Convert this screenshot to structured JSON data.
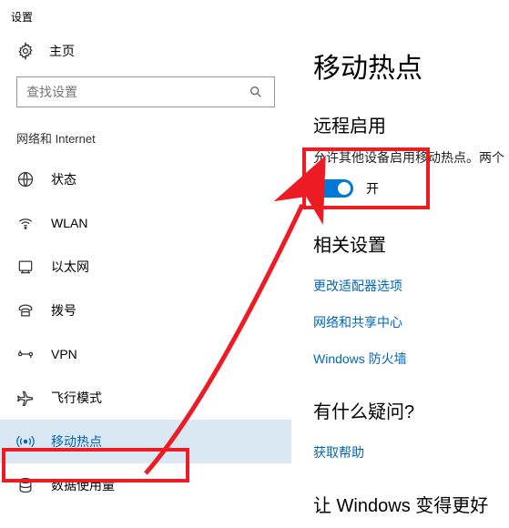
{
  "titlebar": {
    "title": "设置"
  },
  "sidebar": {
    "home_label": "主页",
    "search_placeholder": "查找设置",
    "section_header": "网络和 Internet",
    "items": [
      {
        "label": "状态"
      },
      {
        "label": "WLAN"
      },
      {
        "label": "以太网"
      },
      {
        "label": "拨号"
      },
      {
        "label": "VPN"
      },
      {
        "label": "飞行模式"
      },
      {
        "label": "移动热点"
      },
      {
        "label": "数据使用量"
      }
    ]
  },
  "main": {
    "title": "移动热点",
    "remote_section": {
      "heading": "远程启用",
      "description": "允许其他设备启用移动热点。两个",
      "toggle_state": "开"
    },
    "related_section": {
      "heading": "相关设置",
      "links": [
        "更改适配器选项",
        "网络和共享中心",
        "Windows 防火墙"
      ]
    },
    "help_section": {
      "heading": "有什么疑问?",
      "link": "获取帮助"
    },
    "improve_section": {
      "heading": "让 Windows 变得更好"
    }
  }
}
